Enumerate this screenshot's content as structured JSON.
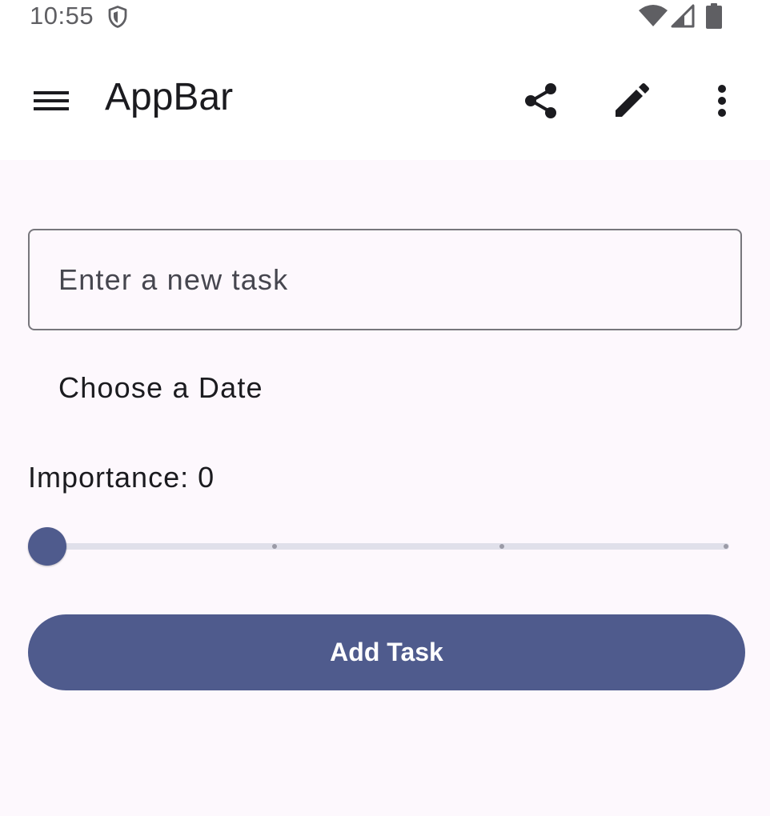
{
  "status_bar": {
    "time": "10:55",
    "icons": [
      "shield-icon",
      "wifi-icon",
      "signal-icon",
      "battery-icon"
    ]
  },
  "app_bar": {
    "title": "AppBar",
    "actions": [
      "share-icon",
      "edit-icon",
      "more-vert-icon"
    ]
  },
  "form": {
    "task_input": {
      "placeholder": "Enter a new task",
      "value": ""
    },
    "date_button_label": "Choose a Date",
    "importance_label": "Importance: 0",
    "importance": {
      "value": 0,
      "min": 0,
      "max": 3,
      "divisions": 3
    },
    "add_button_label": "Add Task"
  },
  "colors": {
    "primary": "#4f5b8d",
    "background": "#fdf8fd",
    "app_bar": "#ffffff",
    "on_surface": "#1b1b1f",
    "outline": "#77767c",
    "track_inactive": "#e0e0ea"
  }
}
